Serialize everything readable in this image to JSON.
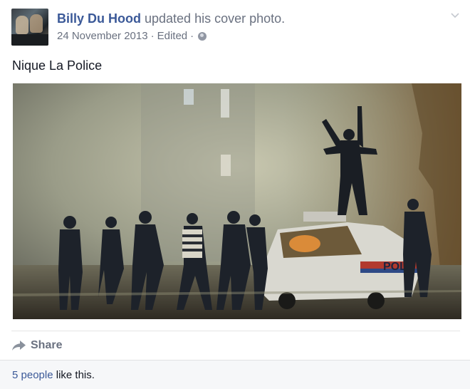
{
  "post": {
    "author_name": "Billy Du Hood",
    "action_text": " updated his cover photo.",
    "date": "24 November 2013",
    "separator": " · ",
    "edited_label": "Edited",
    "separator2": " ·",
    "privacy_icon": "globe-icon",
    "menu_icon": "chevron-down-icon",
    "status_text": "Nique La Police"
  },
  "cover_photo": {
    "car_label": "POL"
  },
  "actions": {
    "share_label": "Share",
    "share_icon": "share-arrow-icon"
  },
  "likes": {
    "count_link": "5 people",
    "suffix": " like this."
  },
  "colors": {
    "link_blue": "#3b5998",
    "meta_gray": "#6a7180",
    "footer_bg": "#f6f7f9"
  }
}
